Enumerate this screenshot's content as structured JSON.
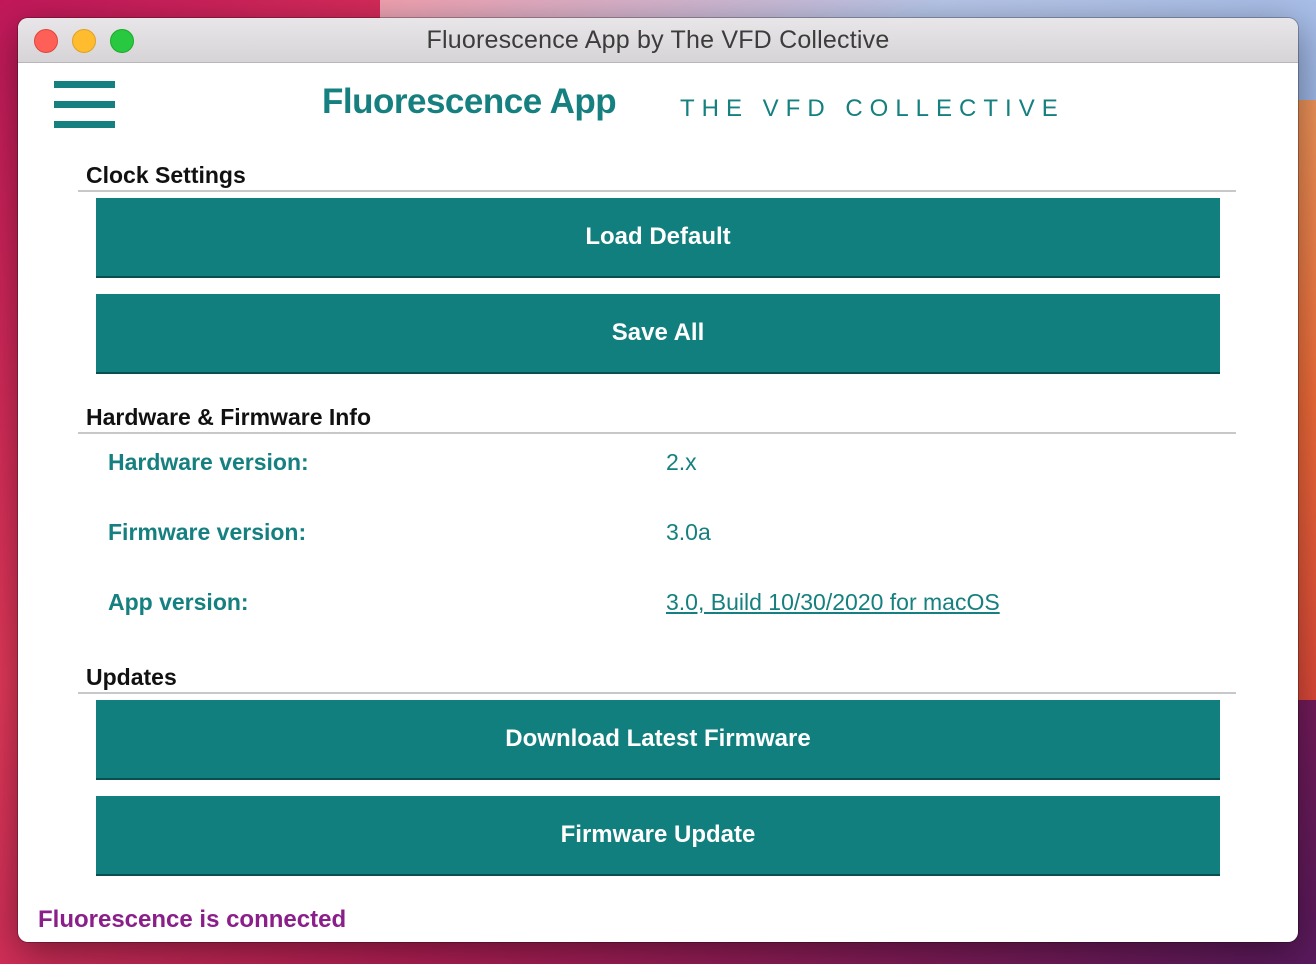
{
  "window": {
    "title": "Fluorescence App by The VFD Collective"
  },
  "header": {
    "brand": "Fluorescence App",
    "subtitle": "THE VFD COLLECTIVE"
  },
  "clock_settings": {
    "title": "Clock Settings",
    "load_default_label": "Load Default",
    "save_all_label": "Save All"
  },
  "info": {
    "title": "Hardware & Firmware Info",
    "hardware_label": "Hardware version:",
    "hardware_value": "2.x",
    "firmware_label": "Firmware version:",
    "firmware_value": "3.0a",
    "app_label": "App version:",
    "app_value": "3.0, Build 10/30/2020 for macOS"
  },
  "updates": {
    "title": "Updates",
    "download_label": "Download Latest Firmware",
    "firmware_update_label": "Firmware Update"
  },
  "status": {
    "text": "Fluorescence is connected",
    "color": "#8a1f8a"
  },
  "colors": {
    "accent": "#127f7f",
    "text_teal": "#15807f"
  },
  "icons": {
    "menu": "hamburger-menu-icon"
  }
}
